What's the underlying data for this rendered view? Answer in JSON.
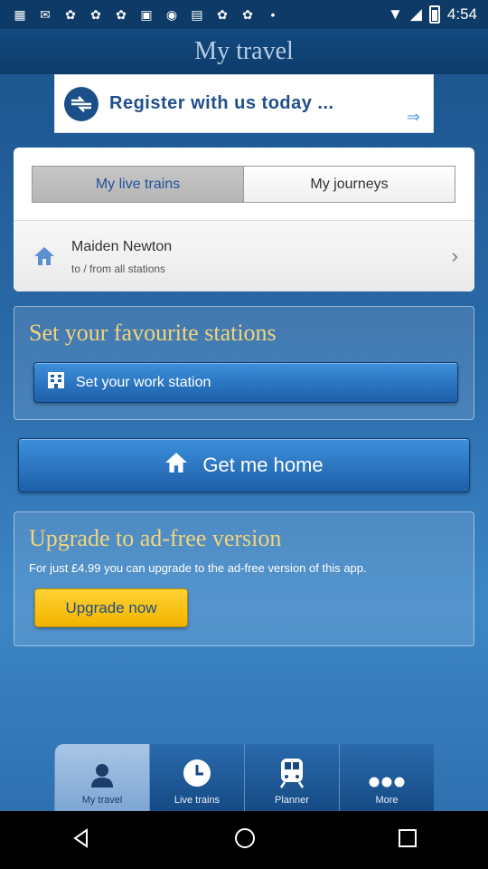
{
  "status_bar": {
    "time": "4:54",
    "notification_icons": [
      "app-icon",
      "app-icon",
      "app-icon",
      "app-icon",
      "app-icon",
      "app-icon",
      "app-icon",
      "app-icon",
      "app-icon",
      "app-icon",
      "app-icon"
    ]
  },
  "header": {
    "title": "My travel"
  },
  "banner": {
    "text": "Register with us today ..."
  },
  "tabs": {
    "live": "My live trains",
    "journeys": "My journeys"
  },
  "station": {
    "name": "Maiden Newton",
    "sub": "to / from all stations"
  },
  "favourites": {
    "title": "Set your favourite stations",
    "work_button": "Set your work station"
  },
  "home_button": "Get me home",
  "upgrade": {
    "title": "Upgrade to ad-free version",
    "text": "For just £4.99 you can upgrade to the ad-free version of this app.",
    "button": "Upgrade now"
  },
  "bottom_nav": {
    "items": [
      {
        "label": "My travel",
        "icon": "person-icon"
      },
      {
        "label": "Live trains",
        "icon": "clock-icon"
      },
      {
        "label": "Planner",
        "icon": "train-icon"
      },
      {
        "label": "More",
        "icon": "more-icon"
      }
    ]
  },
  "colors": {
    "accent": "#1d5fa8",
    "title_gold": "#f3d47a",
    "upgrade_yellow": "#ffd233"
  }
}
